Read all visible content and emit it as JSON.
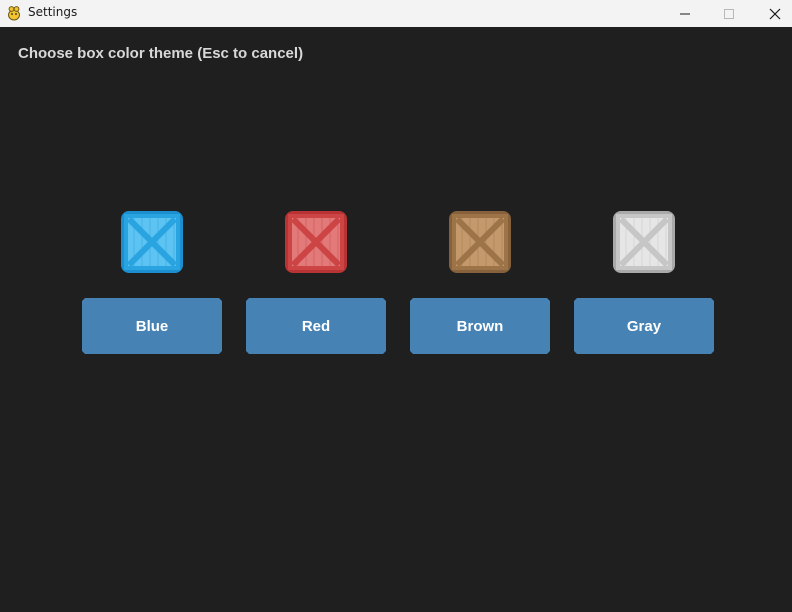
{
  "window": {
    "title": "Settings",
    "icon": "pygame-snake-icon"
  },
  "prompt": "Choose box color theme (Esc to cancel)",
  "options": [
    {
      "label": "Blue",
      "color": "#2a9fd8"
    },
    {
      "label": "Red",
      "color": "#d04545"
    },
    {
      "label": "Brown",
      "color": "#a57a4f"
    },
    {
      "label": "Gray",
      "color": "#d4d4d4"
    }
  ],
  "colors": {
    "background": "#1f1f1f",
    "button": "#4682b4",
    "button_text": "#ffffff",
    "prompt_text": "#d8d8d8"
  }
}
